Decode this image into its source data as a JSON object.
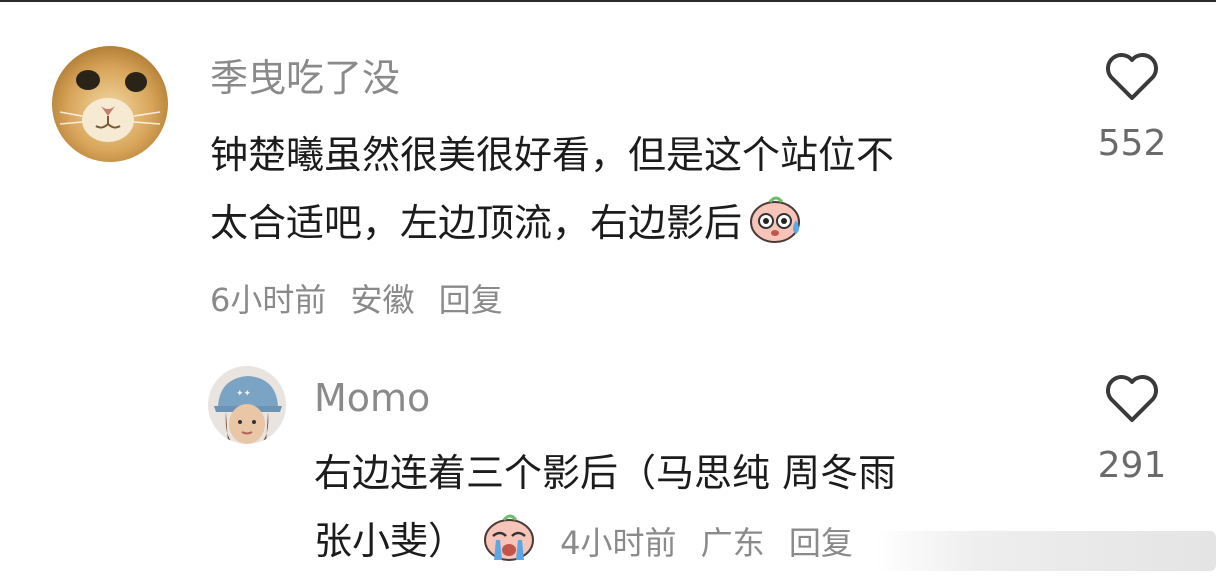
{
  "comments": [
    {
      "username": "季曳吃了没",
      "text_line1": "钟楚曦虽然很美很好看，但是这个站位不",
      "text_line2": "太合适吧，左边顶流，右边影后",
      "time": "6小时前",
      "location": "安徽",
      "reply_label": "回复",
      "likes": "552",
      "avatar": "cat-avatar",
      "emoji": "sweat-face-emoji"
    },
    {
      "username": "Momo",
      "text_line1": "右边连着三个影后（马思纯 周冬雨",
      "text_line2": "张小斐）",
      "time": "4小时前",
      "location": "广东",
      "reply_label": "回复",
      "likes": "291",
      "avatar": "hat-girl-avatar",
      "emoji": "crying-face-emoji"
    }
  ],
  "icons": {
    "like": "heart-outline-icon"
  },
  "colors": {
    "text": "#1c1c1c",
    "muted": "#8a8a8a"
  }
}
